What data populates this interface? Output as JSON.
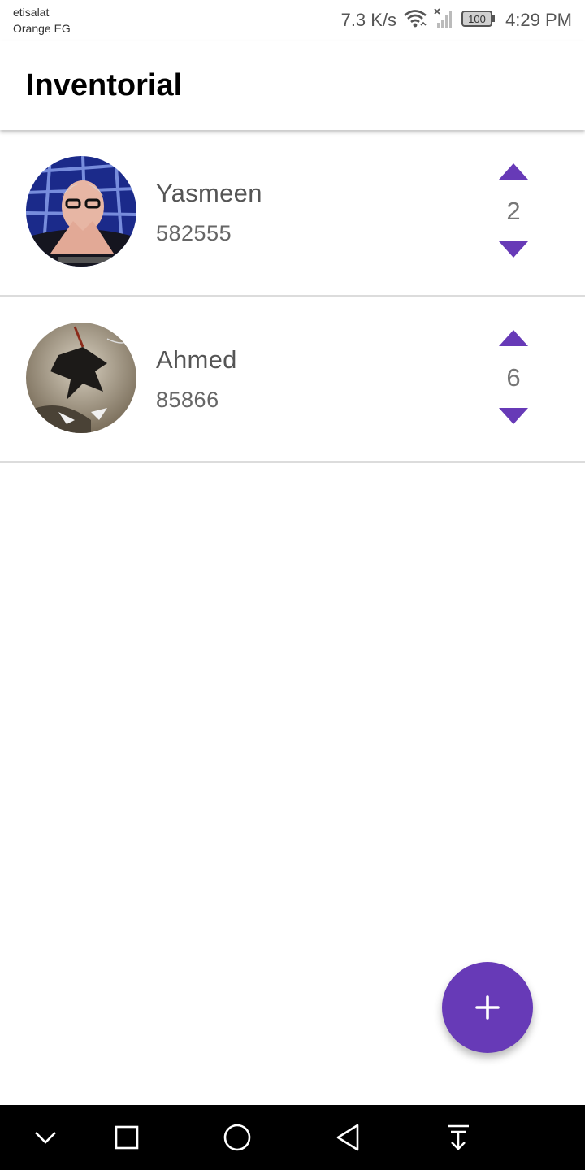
{
  "status_bar": {
    "carrier_line1": "etisalat",
    "carrier_line2": "Orange EG",
    "net_speed": "7.3 K/s",
    "battery": "100",
    "time": "4:29 PM"
  },
  "app_bar": {
    "title": "Inventorial"
  },
  "items": [
    {
      "name": "Yasmeen",
      "code": "582555",
      "quantity": "2",
      "avatar": "person-photo"
    },
    {
      "name": "Ahmed",
      "code": "85866",
      "quantity": "6",
      "avatar": "fantasy-artwork"
    }
  ],
  "fab": {
    "icon": "plus-icon"
  },
  "nav_bar": {
    "icons": [
      "chevron-down-icon",
      "recent-apps-icon",
      "home-icon",
      "back-icon",
      "notification-pull-down-icon"
    ]
  },
  "colors": {
    "accent": "#673ab7",
    "text_primary": "#000000",
    "text_secondary": "#555555",
    "divider": "#dcdcdc",
    "nav_bar": "#000000"
  }
}
